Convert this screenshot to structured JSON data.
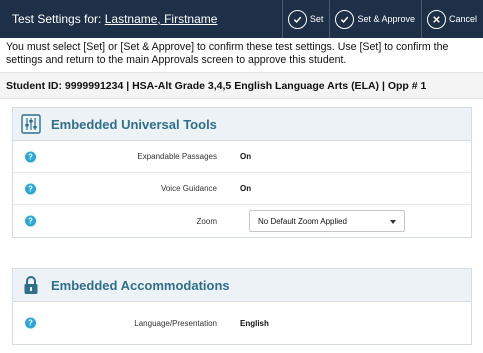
{
  "header": {
    "title_prefix": "Test Settings for: ",
    "student_name": "Lastname, Firstname",
    "set_label": "Set",
    "set_approve_label": "Set & Approve",
    "cancel_label": "Cancel"
  },
  "instructions": "You must select [Set] or [Set & Approve] to confirm these test settings. Use [Set] to confirm the settings and return to the main Approvals screen to approve this student.",
  "student_line": "Student ID: 9999991234 | HSA-Alt Grade 3,4,5 English Language Arts (ELA) | Opp # 1",
  "sections": {
    "universal_tools": {
      "title": "Embedded Universal Tools",
      "rows": [
        {
          "label": "Expandable Passages",
          "value": "On"
        },
        {
          "label": "Voice Guidance",
          "value": "On"
        },
        {
          "label": "Zoom",
          "selected": "No Default Zoom Applied"
        }
      ]
    },
    "accommodations": {
      "title": "Embedded Accommodations",
      "rows": [
        {
          "label": "Language/Presentation",
          "value": "English"
        }
      ]
    }
  },
  "colors": {
    "header_bg": "#1d3047",
    "section_title": "#2e6f8a",
    "help_icon": "#2ba7d8"
  },
  "icons": {
    "set": "check-circle-icon",
    "set_approve": "check-circle-icon",
    "cancel": "x-circle-icon",
    "universal_tools": "sliders-icon",
    "accommodations": "lock-icon",
    "help": "help-icon"
  }
}
